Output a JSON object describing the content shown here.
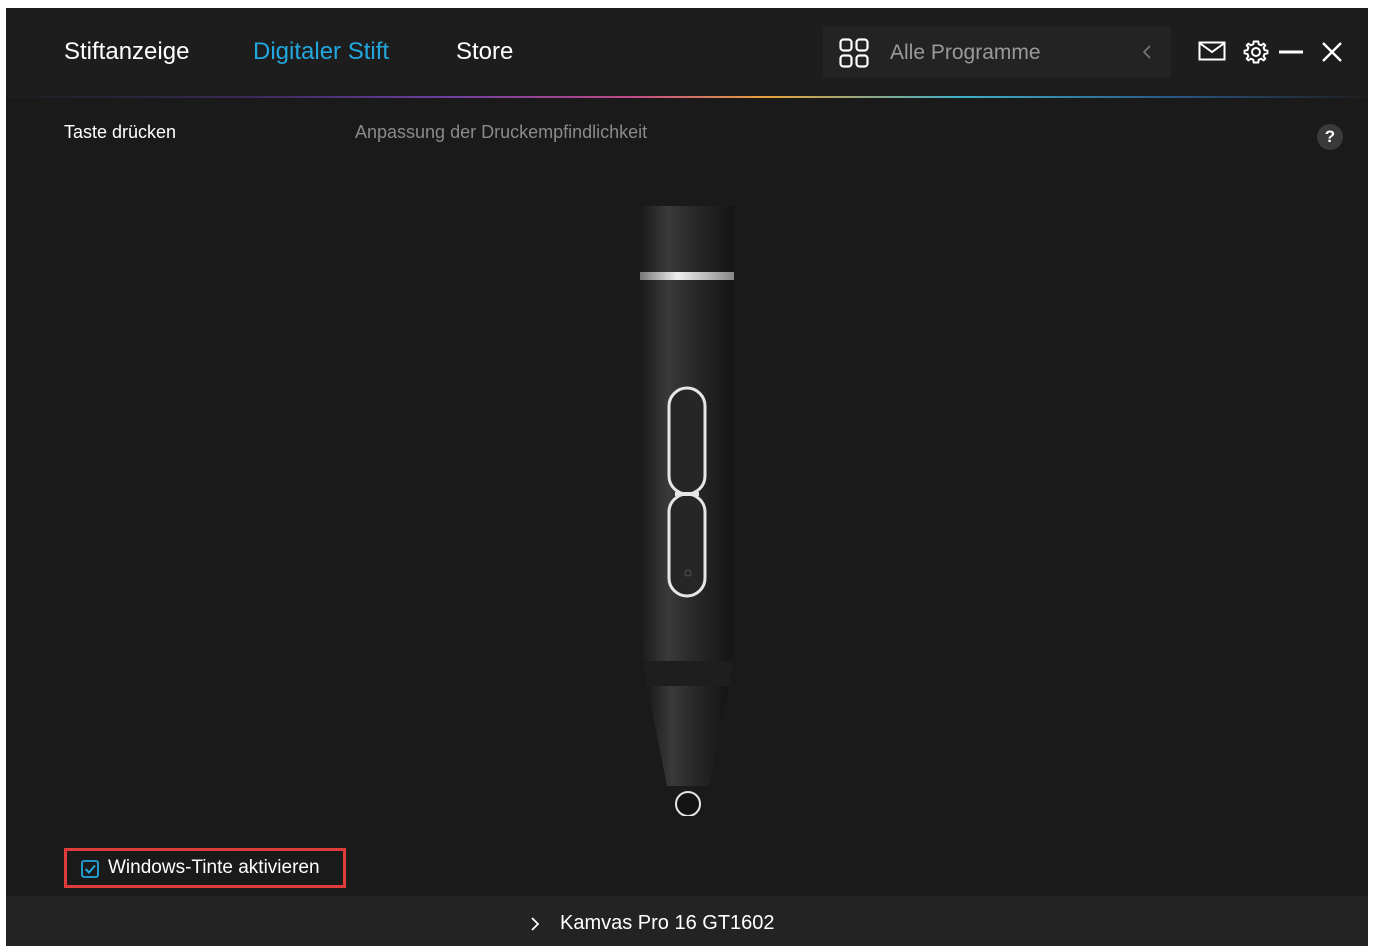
{
  "nav": {
    "tabs": [
      {
        "label": "Stiftanzeige"
      },
      {
        "label": "Digitaler Stift"
      },
      {
        "label": "Store"
      }
    ],
    "active_index": 1
  },
  "app_select": {
    "label": "Alle Programme"
  },
  "subtabs": [
    {
      "label": "Taste drücken"
    },
    {
      "label": "Anpassung der Druckempfindlichkeit"
    }
  ],
  "help": {
    "label": "?"
  },
  "windows_ink": {
    "label": "Windows-Tinte aktivieren",
    "checked": true
  },
  "device": {
    "name": "Kamvas Pro 16 GT1602"
  },
  "colors": {
    "accent": "#22a8de",
    "background": "#1a1a1a",
    "highlight_border": "#e03c3c"
  },
  "icons": {
    "app_select": "grid-icon",
    "app_select_chevron": "chevron-left-icon",
    "mail": "mail-icon",
    "settings": "gear-icon",
    "minimize": "minimize-icon",
    "close": "close-icon",
    "device_expand": "chevron-right-icon"
  }
}
